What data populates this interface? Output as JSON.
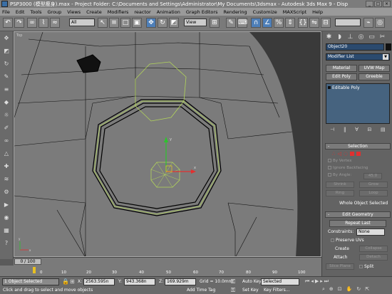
{
  "window": {
    "title": "PSP3000 (模型瘦身).max - Project Folder: C:\\Documents and Settings\\Administrator\\My Documents\\3dsmax - Autodesk 3ds Max 9 - Disp"
  },
  "menu": [
    "File",
    "Edit",
    "Tools",
    "Group",
    "Views",
    "Create",
    "Modifiers",
    "reactor",
    "Animation",
    "Graph Editors",
    "Rendering",
    "Customize",
    "MAXScript",
    "Help"
  ],
  "toolbar": {
    "selection_filter": "All",
    "ref_coord": "View",
    "named_sel": ""
  },
  "viewport": {
    "label": "Top"
  },
  "panel": {
    "object_name": "Object20",
    "modifier_list": "Modifier List",
    "buttons": [
      "Material",
      "UVW Map",
      "Edit Poly",
      "Greeble"
    ],
    "stack_item": "Editable Poly",
    "selection_header": "Selection",
    "by_vertex": "By Vertex",
    "ignore_backfacing": "Ignore Backfacing",
    "by_angle": "By Angle:",
    "by_angle_value": "45.0",
    "shrink": "Shrink",
    "grow": "Grow",
    "ring": "Ring",
    "loop": "Loop",
    "selection_status": "Whole Object Selected",
    "edit_geometry_header": "Edit Geometry",
    "repeat_last": "Repeat Last",
    "constraints_label": "Constraints:",
    "constraints_value": "None",
    "preserve_uvs": "Preserve UVs",
    "create": "Create",
    "collapse": "Collapse",
    "attach": "Attach",
    "detach": "Detach",
    "slice_plane": "Slice Plane",
    "split": "Split"
  },
  "time": {
    "slider": "0 / 100",
    "ticks": [
      "0",
      "10",
      "20",
      "30",
      "40",
      "50",
      "60",
      "70",
      "80",
      "90",
      "100"
    ]
  },
  "status": {
    "selection": "1 Object Selected",
    "prompt": "Click and drag to select and move objects",
    "x_label": "X:",
    "x": "2563.595n",
    "y_label": "Y:",
    "y": "943.368n",
    "z_label": "Z:",
    "z": "169.929m",
    "grid": "Grid = 10.0mm",
    "auto_key": "Auto Key",
    "set_key": "Set Key",
    "key_mode": "Selected",
    "key_filters": "Key Filters...",
    "add_time_tag": "Add Time Tag"
  }
}
